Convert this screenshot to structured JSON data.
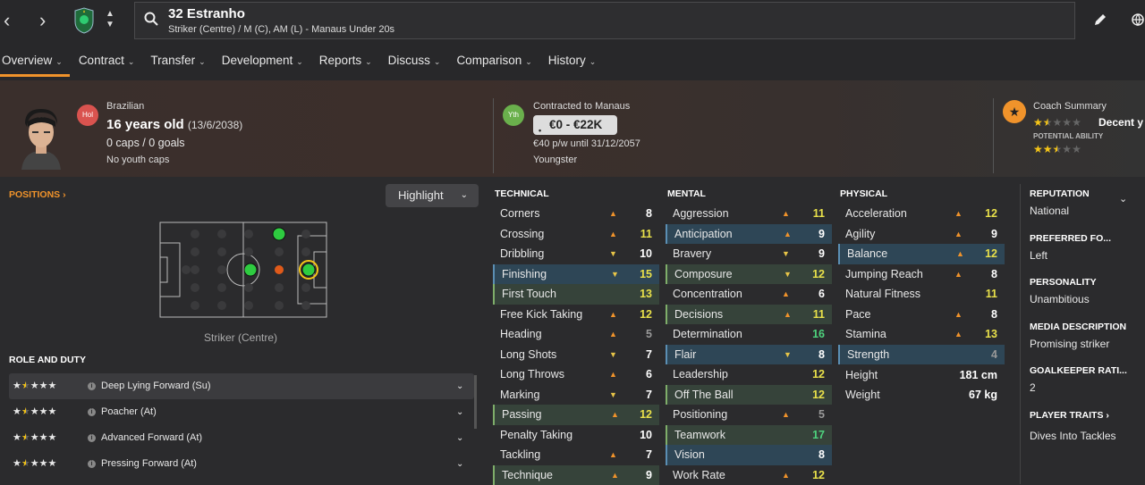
{
  "header": {
    "player_name": "32 Estranho",
    "subtitle": "Striker (Centre) / M (C), AM (L) - Manaus Under 20s"
  },
  "tabs": [
    "Overview",
    "Contract",
    "Transfer",
    "Development",
    "Reports",
    "Discuss",
    "Comparison",
    "History"
  ],
  "profile": {
    "nation_badge": "Hol",
    "nationality": "Brazilian",
    "age": "16 years old",
    "dob": "(13/6/2038)",
    "caps": "0 caps / 0 goals",
    "youth_caps": "No youth caps"
  },
  "contract": {
    "badge": "Yth",
    "title": "Contracted to Manaus",
    "value": "€0 - €22K",
    "wage": "€40 p/w until 31/12/2057",
    "status": "Youngster"
  },
  "coach": {
    "title": "Coach Summary",
    "ca_text": "Decent y",
    "pa_label": "POTENTIAL ABILITY",
    "ca_stars": 1.5,
    "pa_stars": 2.5
  },
  "positions": {
    "title": "POSITIONS",
    "highlight": "Highlight",
    "label": "Striker (Centre)"
  },
  "roles": {
    "title": "ROLE AND DUTY",
    "items": [
      {
        "name": "Deep Lying Forward (Su)",
        "stars": 1.5
      },
      {
        "name": "Poacher (At)",
        "stars": 1.5
      },
      {
        "name": "Advanced Forward (At)",
        "stars": 1.5
      },
      {
        "name": "Pressing Forward (At)",
        "stars": 1.5
      }
    ]
  },
  "technical": {
    "title": "TECHNICAL",
    "rows": [
      {
        "n": "Corners",
        "v": "8",
        "a": "up",
        "h": ""
      },
      {
        "n": "Crossing",
        "v": "11",
        "a": "up",
        "h": ""
      },
      {
        "n": "Dribbling",
        "v": "10",
        "a": "down",
        "h": ""
      },
      {
        "n": "Finishing",
        "v": "15",
        "a": "down",
        "h": "b"
      },
      {
        "n": "First Touch",
        "v": "13",
        "a": "",
        "h": "g"
      },
      {
        "n": "Free Kick Taking",
        "v": "12",
        "a": "up",
        "h": ""
      },
      {
        "n": "Heading",
        "v": "5",
        "a": "up",
        "h": ""
      },
      {
        "n": "Long Shots",
        "v": "7",
        "a": "down",
        "h": ""
      },
      {
        "n": "Long Throws",
        "v": "6",
        "a": "up",
        "h": ""
      },
      {
        "n": "Marking",
        "v": "7",
        "a": "down",
        "h": ""
      },
      {
        "n": "Passing",
        "v": "12",
        "a": "up",
        "h": "g"
      },
      {
        "n": "Penalty Taking",
        "v": "10",
        "a": "",
        "h": ""
      },
      {
        "n": "Tackling",
        "v": "7",
        "a": "up",
        "h": ""
      },
      {
        "n": "Technique",
        "v": "9",
        "a": "up",
        "h": "g"
      }
    ]
  },
  "mental": {
    "title": "MENTAL",
    "rows": [
      {
        "n": "Aggression",
        "v": "11",
        "a": "up",
        "h": ""
      },
      {
        "n": "Anticipation",
        "v": "9",
        "a": "up",
        "h": "b"
      },
      {
        "n": "Bravery",
        "v": "9",
        "a": "down",
        "h": ""
      },
      {
        "n": "Composure",
        "v": "12",
        "a": "down",
        "h": "g"
      },
      {
        "n": "Concentration",
        "v": "6",
        "a": "up",
        "h": ""
      },
      {
        "n": "Decisions",
        "v": "11",
        "a": "up",
        "h": "g"
      },
      {
        "n": "Determination",
        "v": "16",
        "a": "",
        "h": ""
      },
      {
        "n": "Flair",
        "v": "8",
        "a": "down",
        "h": "b"
      },
      {
        "n": "Leadership",
        "v": "12",
        "a": "",
        "h": ""
      },
      {
        "n": "Off The Ball",
        "v": "12",
        "a": "",
        "h": "g"
      },
      {
        "n": "Positioning",
        "v": "5",
        "a": "up",
        "h": ""
      },
      {
        "n": "Teamwork",
        "v": "17",
        "a": "",
        "h": "g"
      },
      {
        "n": "Vision",
        "v": "8",
        "a": "",
        "h": "b"
      },
      {
        "n": "Work Rate",
        "v": "12",
        "a": "up",
        "h": ""
      }
    ]
  },
  "physical": {
    "title": "PHYSICAL",
    "rows": [
      {
        "n": "Acceleration",
        "v": "12",
        "a": "up",
        "h": ""
      },
      {
        "n": "Agility",
        "v": "9",
        "a": "up",
        "h": ""
      },
      {
        "n": "Balance",
        "v": "12",
        "a": "up",
        "h": "b"
      },
      {
        "n": "Jumping Reach",
        "v": "8",
        "a": "up",
        "h": ""
      },
      {
        "n": "Natural Fitness",
        "v": "11",
        "a": "",
        "h": ""
      },
      {
        "n": "Pace",
        "v": "8",
        "a": "up",
        "h": ""
      },
      {
        "n": "Stamina",
        "v": "13",
        "a": "up",
        "h": ""
      },
      {
        "n": "Strength",
        "v": "4",
        "a": "",
        "h": "b"
      }
    ],
    "height_label": "Height",
    "height": "181 cm",
    "weight_label": "Weight",
    "weight": "67 kg"
  },
  "side": {
    "reputation_title": "REPUTATION",
    "reputation": "National",
    "foot_title": "PREFERRED FO...",
    "foot": "Left",
    "personality_title": "PERSONALITY",
    "personality": "Unambitious",
    "media_title": "MEDIA DESCRIPTION",
    "media": "Promising striker",
    "gk_title": "GOALKEEPER RATI...",
    "gk": "2",
    "traits_title": "PLAYER TRAITS",
    "traits": "Dives Into Tackles"
  },
  "colors": {
    "accent": "#f0932b",
    "highlight_blue": "#2e4656",
    "highlight_green": "#36433a"
  }
}
